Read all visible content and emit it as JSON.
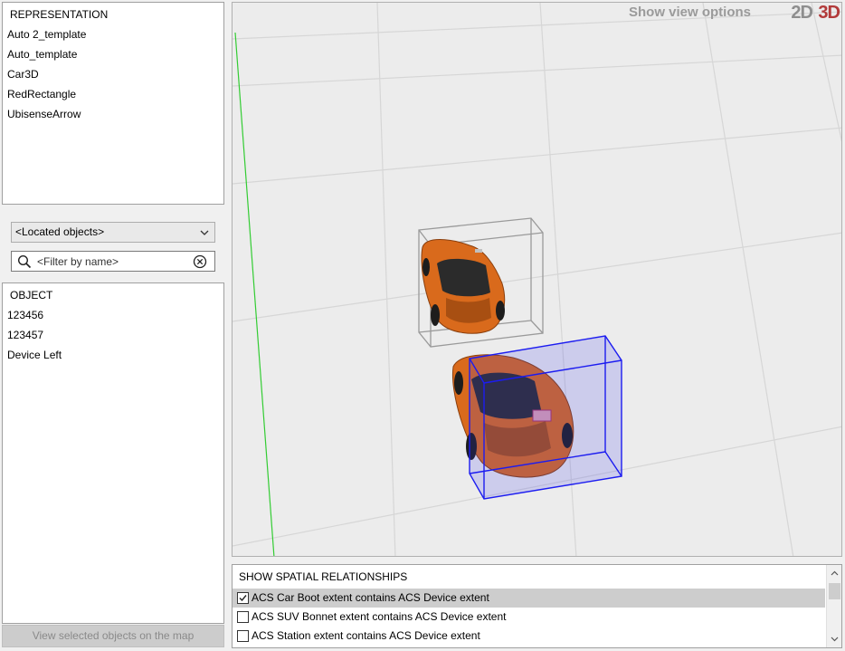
{
  "representation": {
    "header": "REPRESENTATION",
    "items": [
      "Auto 2_template",
      "Auto_template",
      "Car3D",
      "RedRectangle",
      "UbisenseArrow"
    ]
  },
  "object_type": {
    "selected": "<Located objects>"
  },
  "filter": {
    "placeholder": "<Filter by name>",
    "value": ""
  },
  "objects": {
    "header": "OBJECT",
    "items": [
      "123456",
      "123457",
      "Device Left"
    ]
  },
  "view_selected_button": "View selected objects on the map",
  "viewport": {
    "view_options_label": "Show view options",
    "mode_2d": "2D",
    "mode_3d": "3D",
    "car_color": "#d96a1c",
    "selection_box_color": "#1c1cf0",
    "axis_y_color": "#33cc33"
  },
  "spatial": {
    "header": "SHOW SPATIAL RELATIONSHIPS",
    "items": [
      {
        "label": "ACS Car Boot extent contains ACS Device extent",
        "checked": true
      },
      {
        "label": "ACS SUV Bonnet extent contains ACS Device extent",
        "checked": false
      },
      {
        "label": "ACS Station extent contains ACS Device extent",
        "checked": false
      }
    ]
  }
}
